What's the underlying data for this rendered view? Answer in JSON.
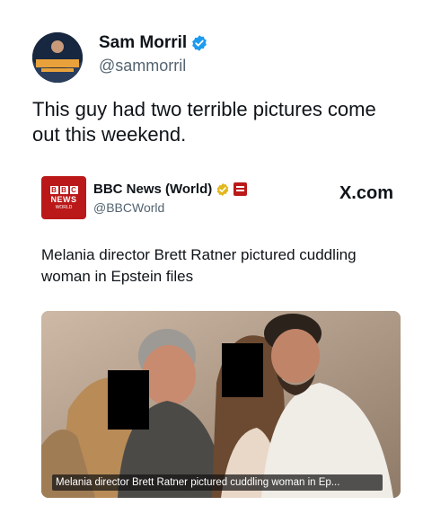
{
  "tweet": {
    "author": {
      "display_name": "Sam Morril",
      "handle": "@sammorril",
      "verified": true,
      "avatar_icon": "profile-photo-avatar"
    },
    "text": "This guy had two terrible pictures come out this weekend."
  },
  "embed": {
    "source": {
      "display_name": "BBC News (World)",
      "handle": "@BBCWorld",
      "logo_icon": "bbc-news-logo",
      "logo_text": {
        "letters": [
          "B",
          "B",
          "C"
        ],
        "news": "NEWS",
        "world": "WORLD"
      },
      "badges": [
        "gold-verified-icon",
        "organization-affiliate-icon"
      ]
    },
    "site": "X.com",
    "headline": "Melania director Brett Ratner pictured cuddling woman in Epstein files",
    "image": {
      "caption": "Melania director Brett Ratner pictured cuddling woman in Ep...",
      "redaction_boxes": 2
    }
  },
  "colors": {
    "verified_blue": "#1d9bf0",
    "gold_badge": "#e2b719",
    "bbc_red": "#bb1919",
    "secondary_text": "#536471"
  }
}
